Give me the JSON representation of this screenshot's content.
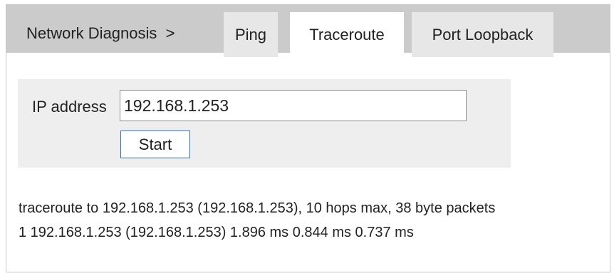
{
  "breadcrumb": {
    "label": "Network Diagnosis",
    "separator": ">"
  },
  "tabs": [
    {
      "label": "Ping",
      "active": false
    },
    {
      "label": "Traceroute",
      "active": true
    },
    {
      "label": "Port Loopback",
      "active": false
    }
  ],
  "form": {
    "ip_label": "IP address",
    "ip_value": "192.168.1.253",
    "start_label": "Start"
  },
  "output": {
    "lines": [
      "traceroute to 192.168.1.253 (192.168.1.253), 10 hops max, 38 byte packets",
      "1 192.168.1.253 (192.168.1.253) 1.896 ms 0.844 ms 0.737 ms"
    ]
  },
  "colors": {
    "tab_bar": "#cbcbcb",
    "tab_inactive": "#e7e7e7",
    "tab_active": "#ffffff",
    "panel": "#eeeeee",
    "button_border": "#2b73c2"
  }
}
